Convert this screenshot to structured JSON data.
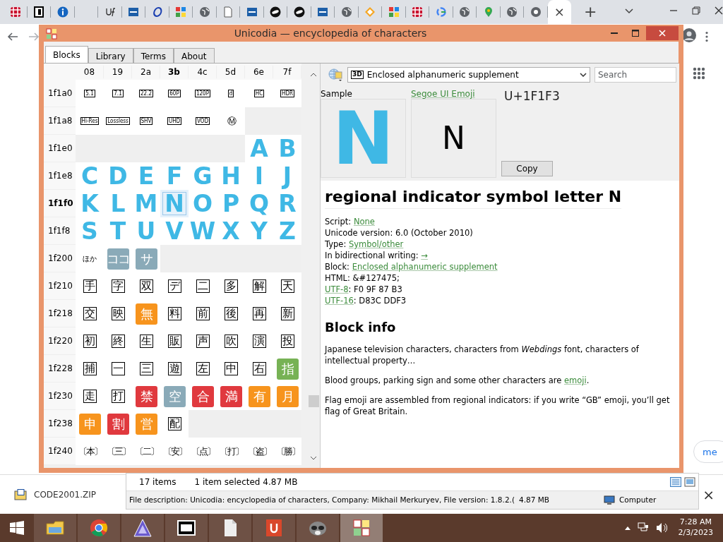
{
  "browser": {
    "tabs": [
      {
        "kind": "grid",
        "selected": false
      },
      {
        "kind": "mono",
        "selected": false
      },
      {
        "kind": "info",
        "selected": false
      },
      {
        "kind": "none",
        "selected": false
      },
      {
        "kind": "script",
        "selected": false
      },
      {
        "kind": "square",
        "selected": false
      },
      {
        "kind": "ring",
        "selected": false
      },
      {
        "kind": "puzzle",
        "selected": false
      },
      {
        "kind": "globe",
        "selected": false
      },
      {
        "kind": "doc",
        "selected": false
      },
      {
        "kind": "square",
        "selected": false
      },
      {
        "kind": "disc",
        "selected": false
      },
      {
        "kind": "disc",
        "selected": false
      },
      {
        "kind": "square",
        "selected": false
      },
      {
        "kind": "globe",
        "selected": false
      },
      {
        "kind": "diamond",
        "selected": false
      },
      {
        "kind": "puzzle",
        "selected": false
      },
      {
        "kind": "grid",
        "selected": false
      },
      {
        "kind": "gring",
        "selected": false
      },
      {
        "kind": "globe",
        "selected": false
      },
      {
        "kind": "pin",
        "selected": false
      },
      {
        "kind": "globe",
        "selected": false
      },
      {
        "kind": "target",
        "selected": false
      },
      {
        "kind": "none",
        "selected": true,
        "close": "×"
      }
    ],
    "new_tab": "+",
    "page_button": "me"
  },
  "window": {
    "title": "Unicodia — encyclopedia of characters",
    "tabs": [
      {
        "label": "Blocks",
        "selected": true
      },
      {
        "label": "Library",
        "selected": false
      },
      {
        "label": "Terms",
        "selected": false
      },
      {
        "label": "About",
        "selected": false
      }
    ],
    "columns": [
      {
        "label": "08",
        "current": false
      },
      {
        "label": "19",
        "current": false
      },
      {
        "label": "2a",
        "current": false
      },
      {
        "label": "3b",
        "current": true
      },
      {
        "label": "4c",
        "current": false
      },
      {
        "label": "5d",
        "current": false
      },
      {
        "label": "6e",
        "current": false
      },
      {
        "label": "7f",
        "current": false
      }
    ],
    "rows": [
      {
        "label": "1f1a0",
        "current": false,
        "cells": [
          {
            "ch": "5.1",
            "kind": "framed",
            "selected": false
          },
          {
            "ch": "7.1",
            "kind": "framed",
            "selected": false
          },
          {
            "ch": "22.2",
            "kind": "framed",
            "selected": false
          },
          {
            "ch": "60P",
            "kind": "framed",
            "selected": false
          },
          {
            "ch": "120P",
            "kind": "framed",
            "selected": false
          },
          {
            "ch": "d",
            "kind": "framed",
            "selected": false
          },
          {
            "ch": "HC",
            "kind": "framed",
            "selected": false
          },
          {
            "ch": "HDR",
            "kind": "framed",
            "selected": false
          }
        ]
      },
      {
        "label": "1f1a8",
        "current": false,
        "cells": [
          {
            "ch": "Hi-Res",
            "kind": "framed",
            "selected": false
          },
          {
            "ch": "Lossless",
            "kind": "framed",
            "selected": false
          },
          {
            "ch": "SHV",
            "kind": "framed",
            "selected": false
          },
          {
            "ch": "UHD",
            "kind": "framed",
            "selected": false
          },
          {
            "ch": "VOD",
            "kind": "framed",
            "selected": false
          },
          {
            "ch": "Ⓜ",
            "kind": "plain",
            "selected": false
          },
          {
            "kind": "empty"
          },
          {
            "kind": "empty"
          }
        ]
      },
      {
        "label": "1f1e0",
        "current": false,
        "cells": [
          {
            "kind": "empty"
          },
          {
            "kind": "empty"
          },
          {
            "kind": "empty"
          },
          {
            "kind": "empty"
          },
          {
            "kind": "empty"
          },
          {
            "kind": "empty"
          },
          {
            "ch": "A",
            "kind": "letter",
            "selected": false
          },
          {
            "ch": "B",
            "kind": "letter",
            "selected": false
          }
        ]
      },
      {
        "label": "1f1e8",
        "current": false,
        "cells": [
          {
            "ch": "C",
            "kind": "letter",
            "selected": false
          },
          {
            "ch": "D",
            "kind": "letter",
            "selected": false
          },
          {
            "ch": "E",
            "kind": "letter",
            "selected": false
          },
          {
            "ch": "F",
            "kind": "letter",
            "selected": false
          },
          {
            "ch": "G",
            "kind": "letter",
            "selected": false
          },
          {
            "ch": "H",
            "kind": "letter",
            "selected": false
          },
          {
            "ch": "I",
            "kind": "letter",
            "selected": false
          },
          {
            "ch": "J",
            "kind": "letter",
            "selected": false
          }
        ]
      },
      {
        "label": "1f1f0",
        "current": true,
        "cells": [
          {
            "ch": "K",
            "kind": "letter",
            "selected": false
          },
          {
            "ch": "L",
            "kind": "letter",
            "selected": false
          },
          {
            "ch": "M",
            "kind": "letter",
            "selected": false
          },
          {
            "ch": "N",
            "kind": "letter",
            "selected": true
          },
          {
            "ch": "O",
            "kind": "letter",
            "selected": false
          },
          {
            "ch": "P",
            "kind": "letter",
            "selected": false
          },
          {
            "ch": "Q",
            "kind": "letter",
            "selected": false
          },
          {
            "ch": "R",
            "kind": "letter",
            "selected": false
          }
        ]
      },
      {
        "label": "1f1f8",
        "current": false,
        "cells": [
          {
            "ch": "S",
            "kind": "letter",
            "selected": false
          },
          {
            "ch": "T",
            "kind": "letter",
            "selected": false
          },
          {
            "ch": "U",
            "kind": "letter",
            "selected": false
          },
          {
            "ch": "V",
            "kind": "letter",
            "selected": false
          },
          {
            "ch": "W",
            "kind": "letter",
            "selected": false
          },
          {
            "ch": "X",
            "kind": "letter",
            "selected": false
          },
          {
            "ch": "Y",
            "kind": "letter",
            "selected": false
          },
          {
            "ch": "Z",
            "kind": "letter",
            "selected": false
          }
        ]
      },
      {
        "label": "1f200",
        "current": false,
        "cells": [
          {
            "ch": "ほか",
            "kind": "small",
            "selected": false
          },
          {
            "ch": "ココ",
            "kind": "emoji",
            "color": "#8aaab8",
            "selected": false
          },
          {
            "ch": "サ",
            "kind": "emoji",
            "color": "#8aaab8",
            "selected": false
          },
          {
            "kind": "empty"
          },
          {
            "kind": "empty"
          },
          {
            "kind": "empty"
          },
          {
            "kind": "empty"
          },
          {
            "kind": "empty"
          }
        ]
      },
      {
        "label": "1f210",
        "current": false,
        "cells": [
          {
            "ch": "手",
            "kind": "framed_kanji",
            "selected": false
          },
          {
            "ch": "字",
            "kind": "framed_kanji",
            "selected": false
          },
          {
            "ch": "双",
            "kind": "framed_kanji",
            "selected": false
          },
          {
            "ch": "デ",
            "kind": "framed_kanji",
            "selected": false
          },
          {
            "ch": "二",
            "kind": "framed_kanji",
            "selected": false
          },
          {
            "ch": "多",
            "kind": "framed_kanji",
            "selected": false
          },
          {
            "ch": "解",
            "kind": "framed_kanji",
            "selected": false
          },
          {
            "ch": "天",
            "kind": "framed_kanji",
            "selected": false
          }
        ]
      },
      {
        "label": "1f218",
        "current": false,
        "cells": [
          {
            "ch": "交",
            "kind": "framed_kanji",
            "selected": false
          },
          {
            "ch": "映",
            "kind": "framed_kanji",
            "selected": false
          },
          {
            "ch": "無",
            "kind": "emoji",
            "color": "#f7941d",
            "selected": false
          },
          {
            "ch": "料",
            "kind": "framed_kanji",
            "selected": false
          },
          {
            "ch": "前",
            "kind": "framed_kanji",
            "selected": false
          },
          {
            "ch": "後",
            "kind": "framed_kanji",
            "selected": false
          },
          {
            "ch": "再",
            "kind": "framed_kanji",
            "selected": false
          },
          {
            "ch": "新",
            "kind": "framed_kanji",
            "selected": false
          }
        ]
      },
      {
        "label": "1f220",
        "current": false,
        "cells": [
          {
            "ch": "初",
            "kind": "framed_kanji",
            "selected": false
          },
          {
            "ch": "終",
            "kind": "framed_kanji",
            "selected": false
          },
          {
            "ch": "生",
            "kind": "framed_kanji",
            "selected": false
          },
          {
            "ch": "販",
            "kind": "framed_kanji",
            "selected": false
          },
          {
            "ch": "声",
            "kind": "framed_kanji",
            "selected": false
          },
          {
            "ch": "吹",
            "kind": "framed_kanji",
            "selected": false
          },
          {
            "ch": "演",
            "kind": "framed_kanji",
            "selected": false
          },
          {
            "ch": "投",
            "kind": "framed_kanji",
            "selected": false
          }
        ]
      },
      {
        "label": "1f228",
        "current": false,
        "cells": [
          {
            "ch": "捕",
            "kind": "framed_kanji",
            "selected": false
          },
          {
            "ch": "一",
            "kind": "framed_kanji",
            "selected": false
          },
          {
            "ch": "三",
            "kind": "framed_kanji",
            "selected": false
          },
          {
            "ch": "遊",
            "kind": "framed_kanji",
            "selected": false
          },
          {
            "ch": "左",
            "kind": "framed_kanji",
            "selected": false
          },
          {
            "ch": "中",
            "kind": "framed_kanji",
            "selected": false
          },
          {
            "ch": "右",
            "kind": "framed_kanji",
            "selected": false
          },
          {
            "ch": "指",
            "kind": "emoji",
            "color": "#77b255",
            "selected": false
          }
        ]
      },
      {
        "label": "1f230",
        "current": false,
        "cells": [
          {
            "ch": "走",
            "kind": "framed_kanji",
            "selected": false
          },
          {
            "ch": "打",
            "kind": "framed_kanji",
            "selected": false
          },
          {
            "ch": "禁",
            "kind": "emoji",
            "color": "#e0393e",
            "selected": false
          },
          {
            "ch": "空",
            "kind": "emoji",
            "color": "#8aaab8",
            "selected": false
          },
          {
            "ch": "合",
            "kind": "emoji",
            "color": "#e0393e",
            "selected": false
          },
          {
            "ch": "満",
            "kind": "emoji",
            "color": "#e0393e",
            "selected": false
          },
          {
            "ch": "有",
            "kind": "emoji",
            "color": "#f7941d",
            "selected": false
          },
          {
            "ch": "月",
            "kind": "emoji",
            "color": "#f7941d",
            "selected": false
          }
        ]
      },
      {
        "label": "1f238",
        "current": false,
        "cells": [
          {
            "ch": "申",
            "kind": "emoji",
            "color": "#f7941d",
            "selected": false
          },
          {
            "ch": "割",
            "kind": "emoji",
            "color": "#e0393e",
            "selected": false
          },
          {
            "ch": "営",
            "kind": "emoji",
            "color": "#f7941d",
            "selected": false
          },
          {
            "ch": "配",
            "kind": "framed_kanji",
            "selected": false
          },
          {
            "kind": "empty"
          },
          {
            "kind": "empty"
          },
          {
            "kind": "empty"
          },
          {
            "kind": "empty"
          }
        ]
      },
      {
        "label": "1f240",
        "current": false,
        "cells": [
          {
            "ch": "〔本〕",
            "kind": "plain",
            "selected": false
          },
          {
            "ch": "〔三〕",
            "kind": "plain",
            "selected": false
          },
          {
            "ch": "〔二〕",
            "kind": "plain",
            "selected": false
          },
          {
            "ch": "〔安〕",
            "kind": "plain",
            "selected": false
          },
          {
            "ch": "〔点〕",
            "kind": "plain",
            "selected": false
          },
          {
            "ch": "〔打〕",
            "kind": "plain",
            "selected": false
          },
          {
            "ch": "〔盗〕",
            "kind": "plain",
            "selected": false
          },
          {
            "ch": "〔勝〕",
            "kind": "plain",
            "selected": false
          }
        ]
      }
    ],
    "block_select": {
      "icon_text": "3D",
      "value": "Enclosed alphanumeric supplement"
    },
    "search": {
      "placeholder": "Search"
    },
    "sample_label": "Sample",
    "font_link": "Segoe UI Emoji",
    "sample_char": "N",
    "font_char": "N",
    "code": "U+1F1F3",
    "copy_button": "Copy",
    "heading": "regional indicator symbol letter N",
    "properties": [
      {
        "parts": [
          {
            "text": "Script: "
          },
          {
            "text": "None",
            "link": true
          }
        ]
      },
      {
        "parts": [
          {
            "text": "Unicode version: 6.0 (October 2010)"
          }
        ]
      },
      {
        "parts": [
          {
            "text": "Type: "
          },
          {
            "text": "Symbol/other",
            "link": true
          }
        ]
      },
      {
        "parts": [
          {
            "text": "In bidirectional writing: "
          },
          {
            "text": "→",
            "link": true
          }
        ]
      },
      {
        "parts": [
          {
            "text": "Block: "
          },
          {
            "text": "Enclosed alphanumeric supplement",
            "link": true
          }
        ]
      },
      {
        "parts": [
          {
            "text": "HTML: &#127475;"
          }
        ]
      },
      {
        "parts": [
          {
            "text": "UTF-8",
            "link": true
          },
          {
            "text": ": F0 9F 87 B3"
          }
        ]
      },
      {
        "parts": [
          {
            "text": "UTF-16",
            "link": true
          },
          {
            "text": ": D83C DDF3"
          }
        ]
      }
    ],
    "block_heading": "Block info",
    "paragraphs": [
      {
        "parts": [
          {
            "text": "Japanese television characters, characters from *Webdings* font, characters of intellectual property…"
          }
        ]
      },
      {
        "parts": [
          {
            "text": "Blood groups, parking sign and some other characters are "
          },
          {
            "text": "emoji",
            "link": true
          },
          {
            "text": "."
          }
        ]
      },
      {
        "parts": [
          {
            "text": "Flag emoji are assembled from regional indicators: if you write “GB” emoji, you’ll get flag of Great Britain."
          }
        ]
      }
    ]
  },
  "explorer_status": {
    "items": "17 items",
    "selection": "1 item selected  4.87 MB",
    "description": "File description: Unicodia: encyclopedia of characters, Company: Mikhail Merkuryev, File version: 1.8.2.(",
    "size": "4.87 MB",
    "location": "Computer"
  },
  "download": {
    "file": "CODE2001.ZIP",
    "close": "×"
  },
  "taskbar": {
    "apps": [
      {
        "kind": "folder",
        "selected": false
      },
      {
        "kind": "chrome",
        "selected": false
      },
      {
        "kind": "triangle",
        "selected": false
      },
      {
        "kind": "archive",
        "selected": false
      },
      {
        "kind": "page",
        "selected": false
      },
      {
        "kind": "red",
        "selected": false
      },
      {
        "kind": "raccoon",
        "selected": false
      },
      {
        "kind": "tiles",
        "selected": true
      }
    ],
    "time": "7:28 AM",
    "date": "2/3/2023"
  }
}
